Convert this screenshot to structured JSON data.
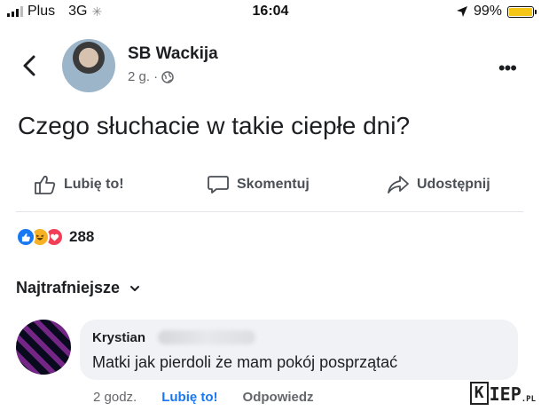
{
  "status_bar": {
    "carrier": "Plus",
    "network": "3G",
    "time": "16:04",
    "battery": "99%",
    "battery_level": 0.99,
    "battery_color": "#f5c518"
  },
  "header": {
    "author": "SB Wackija",
    "meta": "2 g. ·",
    "back_icon": "chevron-left-icon",
    "privacy_icon": "globe-icon",
    "more_label": "•••"
  },
  "post": {
    "text": "Czego słuchacie w takie ciepłe dni?"
  },
  "actions": {
    "like": "Lubię to!",
    "comment": "Skomentuj",
    "share": "Udostępnij"
  },
  "reactions": {
    "count": "288",
    "icons": [
      "like-reaction-icon",
      "haha-reaction-icon",
      "love-reaction-icon"
    ]
  },
  "comments_sort": {
    "label": "Najtrafniejsze"
  },
  "comment": {
    "author": "Krystian",
    "text": "Matki jak pierdoli że mam pokój posprzątać",
    "time": "2 godz.",
    "like": "Lubię to!",
    "reply": "Odpowiedz"
  },
  "watermark": {
    "k": "K",
    "main": "IEP",
    "tld": ".PL"
  },
  "colors": {
    "accent": "#1877f2",
    "like_reaction": "#1877f2",
    "haha_reaction": "#f7b125",
    "love_reaction": "#f33e58",
    "comment_bubble": "#f0f2f5"
  }
}
